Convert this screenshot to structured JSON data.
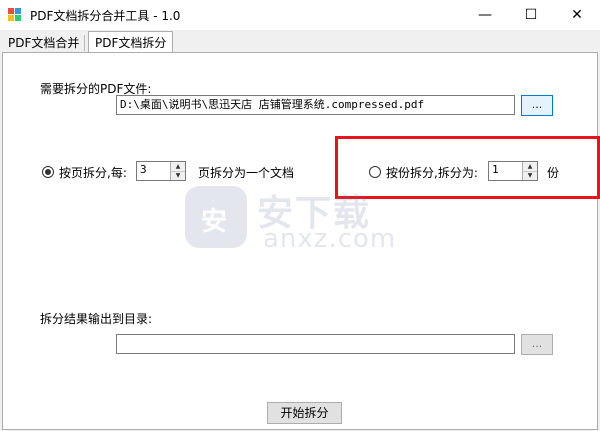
{
  "window": {
    "title": "PDF文档拆分合并工具 - 1.0",
    "minimize_glyph": "—",
    "maximize_glyph": "☐",
    "close_glyph": "✕"
  },
  "tabs": [
    {
      "label": "PDF文档合并",
      "active": false
    },
    {
      "label": "PDF文档拆分",
      "active": true
    }
  ],
  "split": {
    "source_label": "需要拆分的PDF文件:",
    "source_path": "D:\\桌面\\说明书\\思迅天店 店铺管理系统.compressed.pdf",
    "browse_label": "...",
    "by_pages_label": "按页拆分,每:",
    "by_pages_value": "3",
    "by_pages_suffix": "页拆分为一个文档",
    "by_count_label": "按份拆分,拆分为:",
    "by_count_value": "1",
    "by_count_suffix": "份",
    "mode": "by_pages",
    "output_label": "拆分结果输出到目录:",
    "output_path": "",
    "output_browse_label": "...",
    "start_label": "开始拆分"
  },
  "watermark": {
    "shield_char": "安",
    "brand_text": "安下载",
    "url_text": "anxz.com"
  },
  "colors": {
    "highlight_border": "#e8131b",
    "accent": "#0078d7"
  }
}
